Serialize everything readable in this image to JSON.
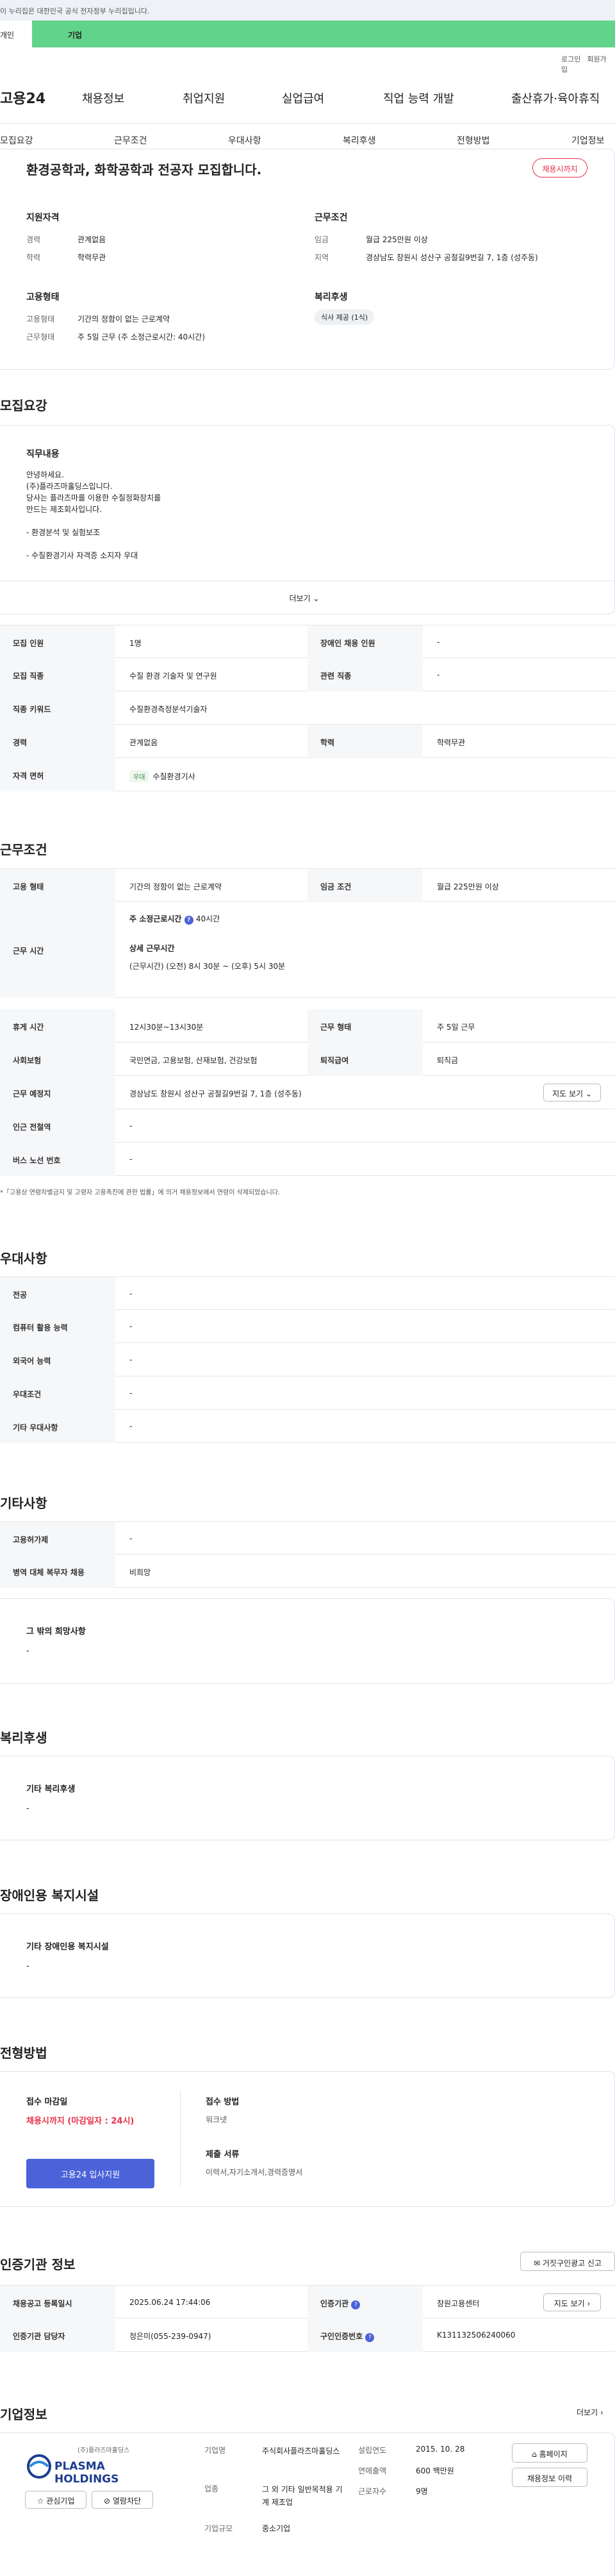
{
  "gov_banner": "이 누리집은 대한민국 공식 전자정부 누리집입니다.",
  "portal_tabs": {
    "personal": "개인",
    "company": "기업"
  },
  "util": {
    "login": "로그인",
    "join": "회원가입"
  },
  "nav": {
    "logo": "고용24",
    "items": [
      "채용정보",
      "취업지원",
      "실업급여",
      "직업 능력 개발",
      "출산휴가·육아휴직"
    ]
  },
  "section_tabs": [
    "모집요강",
    "근무조건",
    "우대사항",
    "복리후생",
    "전형방법",
    "기업정보"
  ],
  "summary": {
    "title": "환경공학과, 화학공학과 전공자 모집합니다.",
    "badge": "채용시까지",
    "qual_title": "지원자격",
    "qual": [
      {
        "k": "경력",
        "v": "관계없음"
      },
      {
        "k": "학력",
        "v": "학력무관"
      }
    ],
    "cond_title": "근무조건",
    "cond": [
      {
        "k": "임금",
        "v": "월급 225만원 이상"
      },
      {
        "k": "지역",
        "v": "경상남도 창원시 성산구 공절길9번길 7, 1층 (성주동)"
      }
    ],
    "emp_title": "고용형태",
    "emp": [
      {
        "k": "고용형태",
        "v": "기간의 정함이 없는 근로계약"
      },
      {
        "k": "근무형태",
        "v": "주 5일 근무 (주 소정근로시간: 40시간)"
      }
    ],
    "welfare_title": "복리후생",
    "welfare_tag": "식사 제공 (1식)"
  },
  "recruit": {
    "heading": "모집요강",
    "duty_title": "직무내용",
    "duty_lines": [
      "안녕하세요.",
      "(주)플라즈마홀딩스입니다.",
      "당사는 플라즈마를 이용한 수질정화장치를",
      "만드는 제조회사입니다.",
      "",
      "- 환경분석 및 실험보조",
      "",
      "- 수질환경기사 자격증 소지자 우대"
    ],
    "more": "더보기",
    "rows": [
      {
        "k": "모집 인원",
        "v": "1명",
        "k2": "장애인 채용 인원",
        "v2": "-"
      },
      {
        "k": "모집 직종",
        "v": "수질 환경 기술자 및 연구원",
        "k2": "관련 직종",
        "v2": "-"
      },
      {
        "k": "직종 키워드",
        "v": "수질환경측정분석기술자",
        "k2": "",
        "v2": ""
      },
      {
        "k": "경력",
        "v": "관계없음",
        "k2": "학력",
        "v2": "학력무관"
      }
    ],
    "license_k": "자격 면허",
    "license_badge": "우대",
    "license_v": "수질환경기사"
  },
  "work": {
    "heading": "근무조건",
    "type_k": "고용 형태",
    "type_v": "기간의 정함이 없는 근로계약",
    "wage_k": "임금 조건",
    "wage_v": "월급 225만원 이상",
    "time_k": "근무 시간",
    "time_a": "주 소정근로시간",
    "time_a_v": "40시간",
    "time_b": "상세 근무시간",
    "time_b_v": "(근무시간) (오전) 8시 30분 ~ (오후) 5시 30분",
    "rest_k": "휴게 시간",
    "rest_v": "12시30분~13시30분",
    "form_k": "근무 형태",
    "form_v": "주 5일 근무",
    "ins_k": "사회보험",
    "ins_v": "국민연금, 고용보험, 산재보험, 건강보험",
    "ret_k": "퇴직급여",
    "ret_v": "퇴직금",
    "place_k": "근무 예정지",
    "place_v": "경상남도 창원시 성산구 공절길9번길 7, 1층 (성주동)",
    "map": "지도 보기",
    "sub_k": "인근 전철역",
    "sub_v": "-",
    "bus_k": "버스 노선 번호",
    "bus_v": "-",
    "note": "*「고용상 연령차별금지 및 고령자 고용촉진에 관한 법률」에 의거 채용정보에서 연령이 삭제되었습니다."
  },
  "pref": {
    "heading": "우대사항",
    "rows": [
      {
        "k": "전공",
        "v": "-"
      },
      {
        "k": "컴퓨터 활용 능력",
        "v": "-"
      },
      {
        "k": "외국어 능력",
        "v": "-"
      },
      {
        "k": "우대조건",
        "v": "-"
      },
      {
        "k": "기타 우대사항",
        "v": "-"
      }
    ]
  },
  "etc": {
    "heading": "기타사항",
    "rows": [
      {
        "k": "고용허가제",
        "v": "-"
      },
      {
        "k": "병역 대체 복무자 채용",
        "v": "비희망"
      }
    ],
    "box_title": "그 밖의 희망사항",
    "box_v": "-"
  },
  "welfare": {
    "heading": "복리후생",
    "box_title": "기타 복리후생",
    "box_v": "-"
  },
  "disabled": {
    "heading": "장애인용 복지시설",
    "box_title": "기타 장애인용 복지시설",
    "box_v": "-"
  },
  "select": {
    "heading": "전형방법",
    "deadline_title": "접수 마감일",
    "deadline_v": "채용시까지 (마감일자 : 24시)",
    "apply_btn": "고용24 입사지원",
    "method_title": "접수 방법",
    "method_v": "워크넷",
    "docs_title": "제출 서류",
    "docs_v": "이력서,자기소개서,경력증명서"
  },
  "cert": {
    "heading": "인증기관 정보",
    "report_btn": "거짓구인광고 신고",
    "reg_k": "채용공고 등록일시",
    "reg_v": "2025.06.24 17:44:06",
    "org_k": "인증기관",
    "org_v": "창원고용센터",
    "map": "지도 보기",
    "mgr_k": "인증기관 담당자",
    "mgr_v": "정은미(055-239-0947)",
    "num_k": "구인인증번호",
    "num_v": "K131132506240060"
  },
  "company": {
    "heading": "기업정보",
    "more": "더보기",
    "logo_kr": "(주)플라즈마홀딩스",
    "logo_en": "PLASMA HOLDINGS",
    "fav": "관심기업",
    "block": "열람차단",
    "name_k": "기업명",
    "name_v": "주식회사플라즈마홀딩스",
    "ind_k": "업종",
    "ind_v": "그 외 기타 일반목적용 기계 제조업",
    "size_k": "기업규모",
    "size_v": "중소기업",
    "est_k": "설립연도",
    "est_v": "2015. 10. 28",
    "sales_k": "연매출액",
    "sales_v": "600 백만원",
    "emp_k": "근로자수",
    "emp_v": "9명",
    "home_btn": "홈페이지",
    "list_btn": "채용정보 이력"
  },
  "colors": {
    "accent": "#4b62d8",
    "red": "#e8334a",
    "green_tab": "#62d38a"
  }
}
